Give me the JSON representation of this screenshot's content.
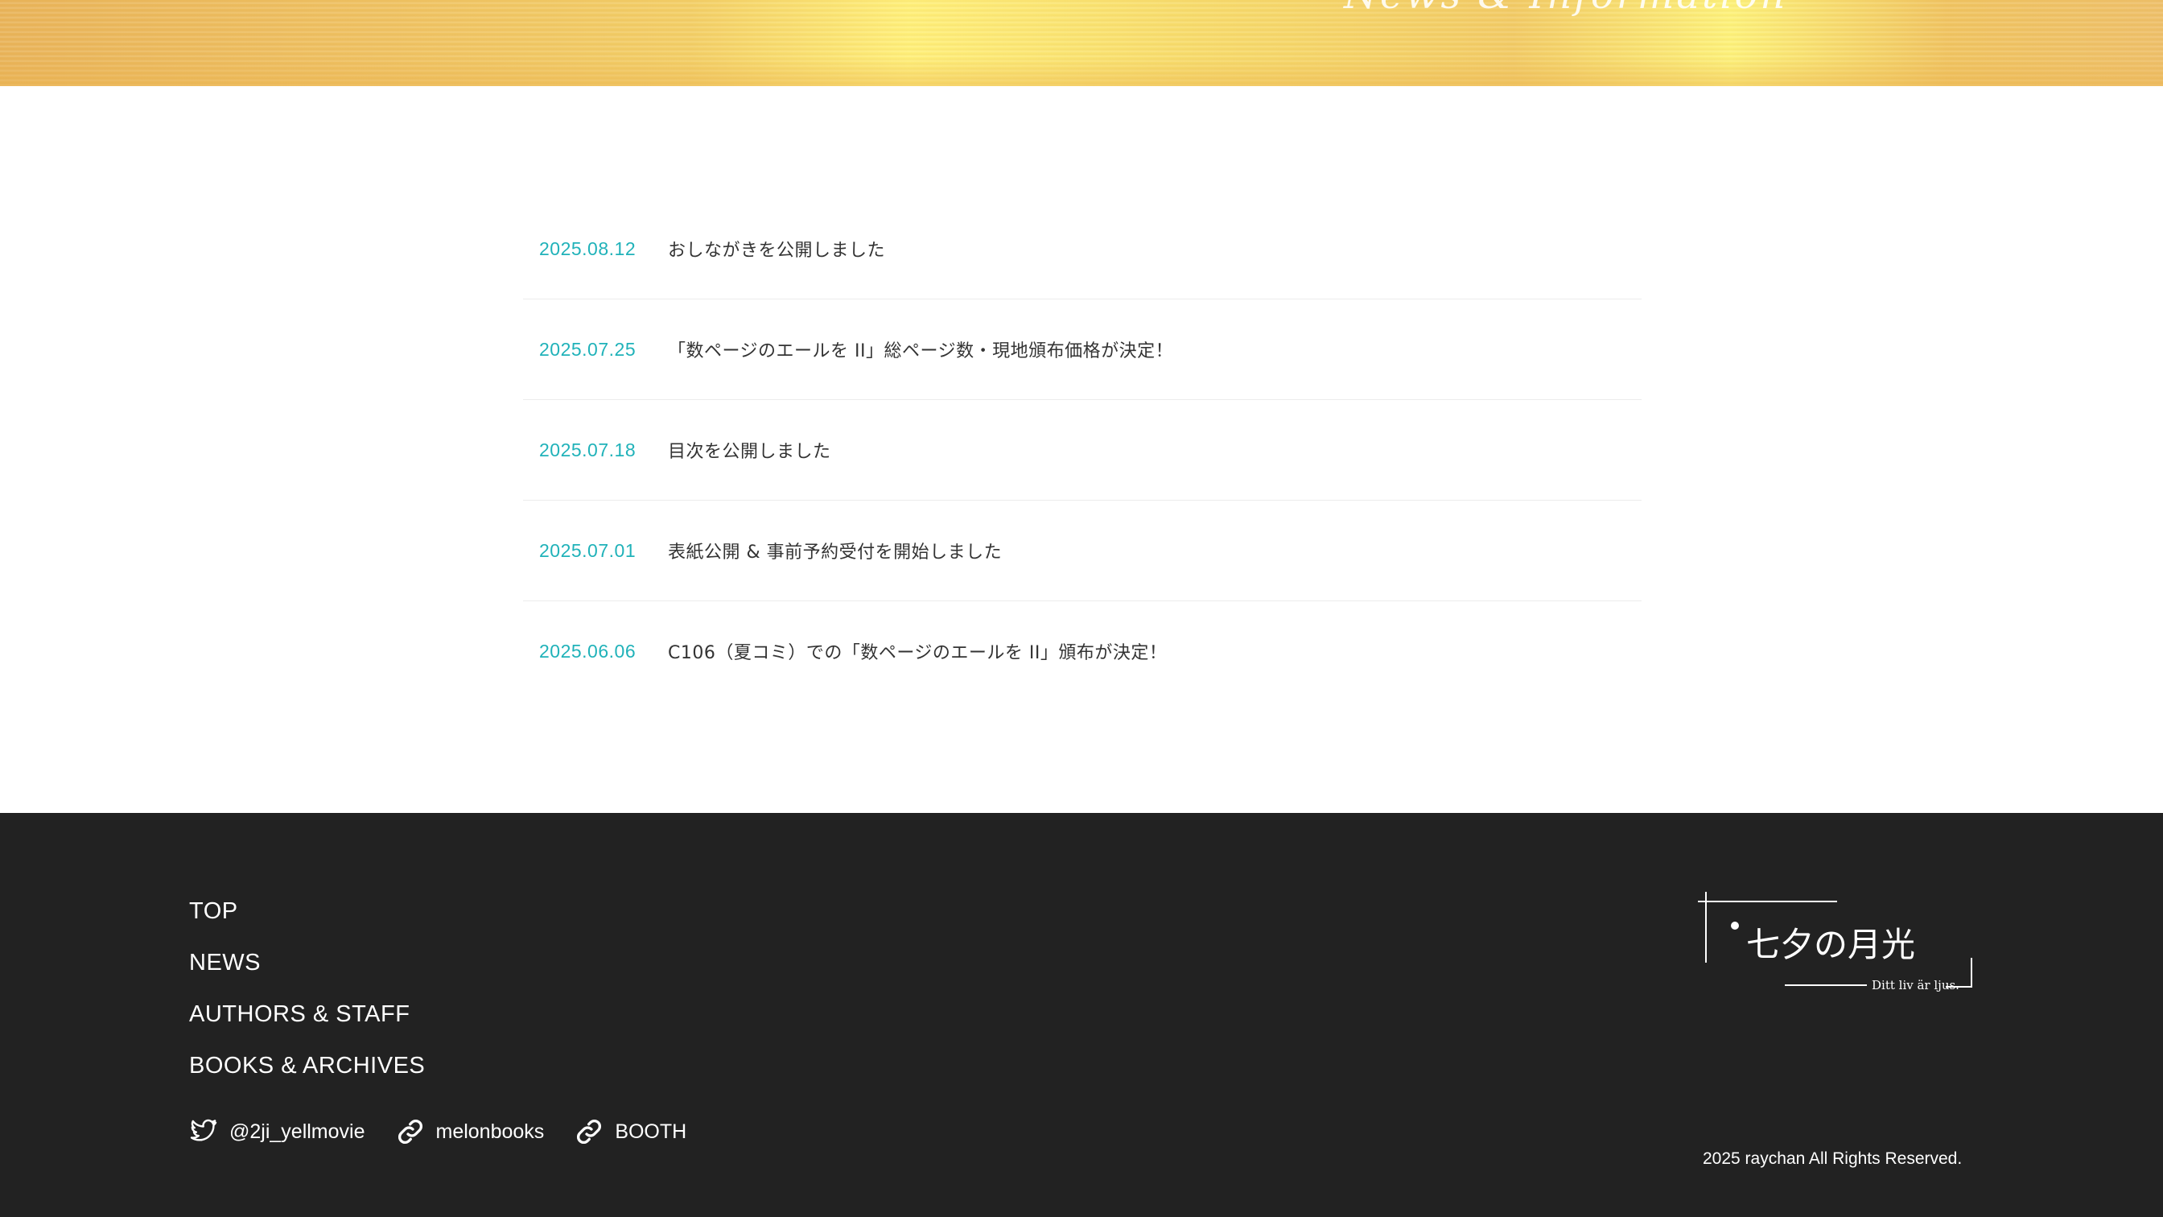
{
  "hero": {
    "title": "News & Information"
  },
  "news": [
    {
      "date": "2025.08.12",
      "title": "おしながきを公開しました"
    },
    {
      "date": "2025.07.25",
      "title": "「数ページのエールを II」総ページ数・現地頒布価格が決定！"
    },
    {
      "date": "2025.07.18",
      "title": "目次を公開しました"
    },
    {
      "date": "2025.07.01",
      "title": "表紙公開 & 事前予約受付を開始しました"
    },
    {
      "date": "2025.06.06",
      "title": "C106（夏コミ）での「数ページのエールを II」頒布が決定！"
    }
  ],
  "footer": {
    "nav": [
      "TOP",
      "NEWS",
      "AUTHORS & STAFF",
      "BOOKS & ARCHIVES"
    ],
    "social": [
      {
        "label": "@2ji_yellmovie",
        "icon": "twitter-icon"
      },
      {
        "label": "melonbooks",
        "icon": "link-icon"
      },
      {
        "label": "BOOTH",
        "icon": "link-icon"
      }
    ],
    "logo": {
      "title": "七夕の月光",
      "subtitle": "Ditt liv är ljus."
    },
    "copyright": "2025 raychan All Rights Reserved."
  },
  "colors": {
    "accent": "#20b2b9",
    "footer_bg": "#222222",
    "text": "#333333"
  }
}
